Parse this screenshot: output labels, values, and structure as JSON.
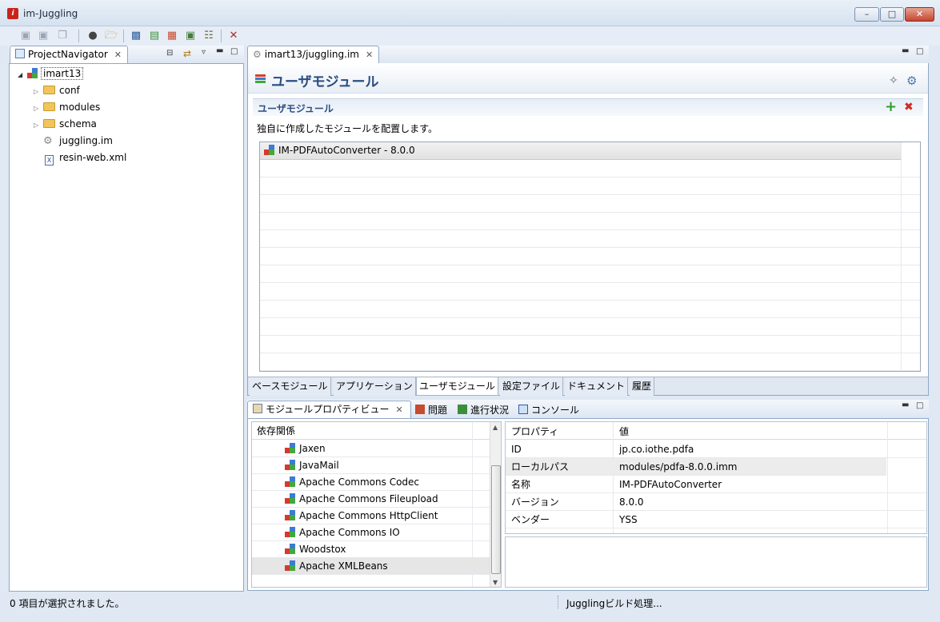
{
  "window": {
    "title": "im-Juggling"
  },
  "toolbar": {
    "icons": [
      "save-icon",
      "save-as-icon",
      "save-all-icon",
      "server-icon",
      "open-folder-icon",
      "monitor-icon",
      "add-icon",
      "report-icon",
      "image-icon",
      "tree-icon",
      "tools-icon"
    ]
  },
  "navigator": {
    "tab_label": "ProjectNavigator",
    "root": "imart13",
    "items": [
      {
        "label": "conf",
        "type": "folder"
      },
      {
        "label": "modules",
        "type": "folder"
      },
      {
        "label": "schema",
        "type": "folder"
      },
      {
        "label": "juggling.im",
        "type": "file"
      },
      {
        "label": "resin-web.xml",
        "type": "xml"
      }
    ]
  },
  "editor": {
    "tab_label": "imart13/juggling.im",
    "title": "ユーザモジュール",
    "section_title": "ユーザモジュール",
    "description": "独自に作成したモジュールを配置します。",
    "modules": [
      "IM-PDFAutoConverter - 8.0.0"
    ],
    "bottom_tabs": [
      "ベースモジュール",
      "アプリケーション",
      "ユーザモジュール",
      "設定ファイル",
      "ドキュメント",
      "履歴"
    ],
    "active_bottom_tab": 2
  },
  "bottom_panel": {
    "tabs": [
      "モジュールプロパティビュー",
      "問題",
      "進行状況",
      "コンソール"
    ],
    "dependency_header": "依存関係",
    "dependencies": [
      "Jaxen",
      "JavaMail",
      "Apache Commons Codec",
      "Apache Commons Fileupload",
      "Apache Commons HttpClient",
      "Apache Commons IO",
      "Woodstox",
      "Apache XMLBeans"
    ],
    "property_header": "プロパティ",
    "value_header": "値",
    "properties": [
      {
        "key": "ID",
        "value": "jp.co.iothe.pdfa"
      },
      {
        "key": "ローカルパス",
        "value": "modules/pdfa-8.0.0.imm"
      },
      {
        "key": "名称",
        "value": "IM-PDFAutoConverter"
      },
      {
        "key": "バージョン",
        "value": "8.0.0"
      },
      {
        "key": "ベンダー",
        "value": "YSS"
      }
    ]
  },
  "status": {
    "left": "0 項目が選択されました。",
    "right": "Jugglingビルド処理..."
  }
}
